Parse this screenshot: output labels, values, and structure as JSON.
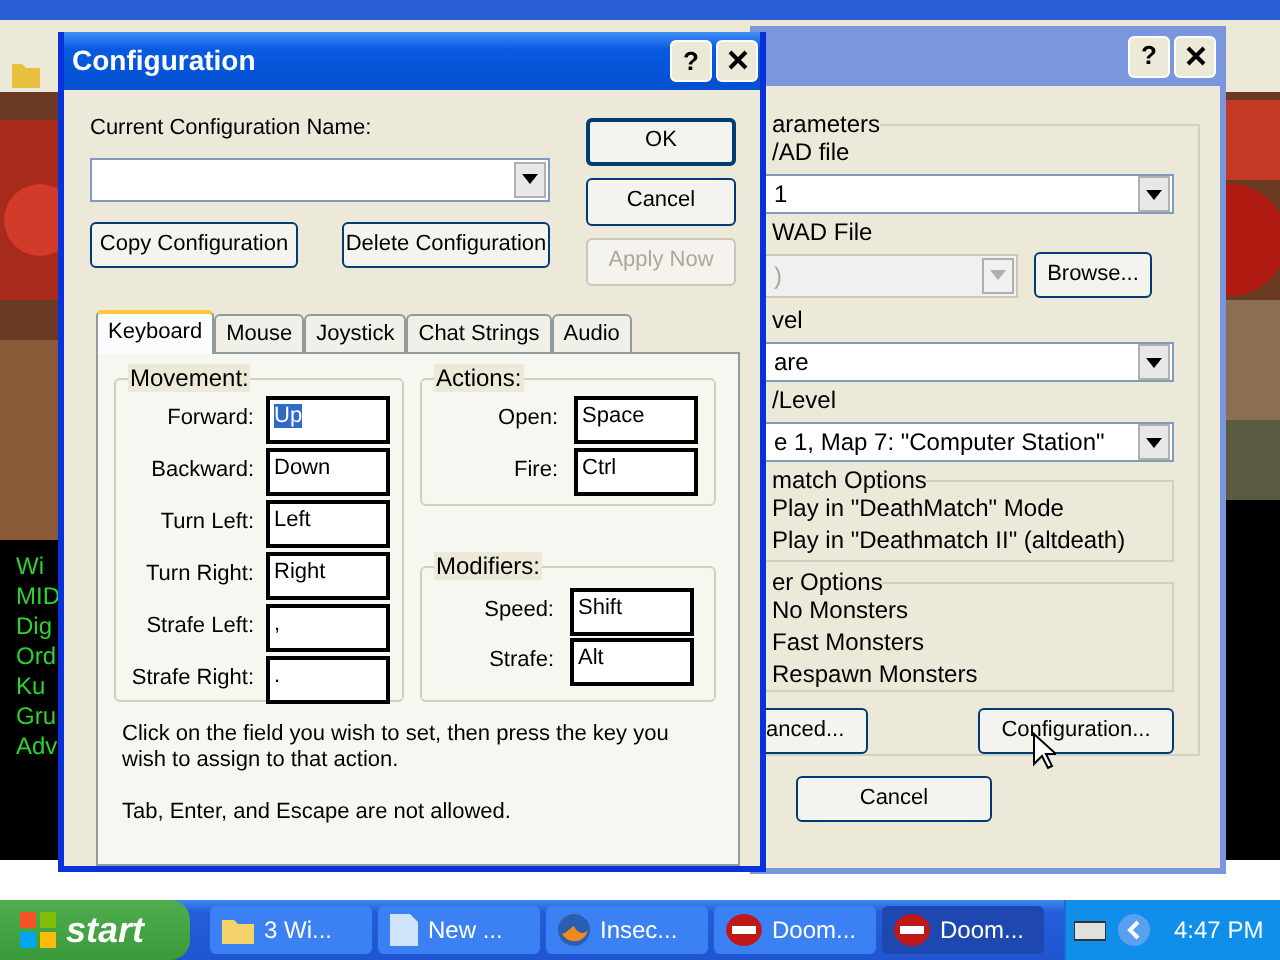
{
  "desktop_text": [
    "Wi",
    "MID",
    "Dig",
    "Ord",
    "Ku",
    "Gru",
    "Adv"
  ],
  "launcher": {
    "help_button": "?",
    "group_label": "arameters",
    "wad_label": "/AD file",
    "wad_value": "1",
    "pwad_label": "WAD File",
    "pwad_value": ")",
    "browse_button": "Browse...",
    "skill_label": "vel",
    "skill_value": "are",
    "map_label": "/Level",
    "map_value": "e 1, Map 7: \"Computer Station\"",
    "dm_label": "match Options",
    "dm_options": [
      "Play in \"DeathMatch\" Mode",
      "Play in \"Deathmatch II\" (altdeath)"
    ],
    "other_label": "er Options",
    "other_options": [
      "No Monsters",
      "Fast Monsters",
      "Respawn Monsters"
    ],
    "buttons": [
      "anced...",
      "Configuration..."
    ],
    "cancel_button": "Cancel"
  },
  "dialog": {
    "title": "Configuration",
    "help_button": "?",
    "name_label": "Current Configuration Name:",
    "side_buttons": [
      {
        "label": "OK",
        "disabled": false,
        "default": true
      },
      {
        "label": "Cancel",
        "disabled": false,
        "default": false
      },
      {
        "label": "Apply Now",
        "disabled": true,
        "default": false
      }
    ],
    "buttons": [
      "Copy Configuration",
      "Delete Configuration"
    ],
    "tabs": [
      {
        "label": "Keyboard",
        "selected": true
      },
      {
        "label": "Mouse",
        "selected": false
      },
      {
        "label": "Joystick",
        "selected": false
      },
      {
        "label": "Chat Strings",
        "selected": false
      },
      {
        "label": "Audio",
        "selected": false
      }
    ],
    "movement": {
      "title": "Movement:",
      "fields": [
        {
          "label": "Forward:",
          "value": "Up",
          "focused": true
        },
        {
          "label": "Backward:",
          "value": "Down",
          "focused": false
        },
        {
          "label": "Turn Left:",
          "value": "Left",
          "focused": false
        },
        {
          "label": "Turn Right:",
          "value": "Right",
          "focused": false
        },
        {
          "label": "Strafe Left:",
          "value": ",",
          "focused": false
        },
        {
          "label": "Strafe Right:",
          "value": ".",
          "focused": false
        }
      ]
    },
    "actions": {
      "title": "Actions:",
      "fields": [
        {
          "label": "Open:",
          "value": "Space",
          "focused": false
        },
        {
          "label": "Fire:",
          "value": "Ctrl",
          "focused": false
        }
      ]
    },
    "modifiers": {
      "title": "Modifiers:",
      "fields": [
        {
          "label": "Speed:",
          "value": "Shift",
          "focused": false
        },
        {
          "label": "Strafe:",
          "value": "Alt",
          "focused": false
        }
      ]
    },
    "notes": [
      "Click on the field you wish to set, then press the key you wish to assign to that action.",
      "Tab, Enter, and Escape are not allowed."
    ]
  },
  "taskbar": {
    "start": "start",
    "items": [
      {
        "label": "3 Wi...",
        "kind": "folder",
        "selected": false
      },
      {
        "label": "New ...",
        "kind": "document",
        "selected": false
      },
      {
        "label": "Insec...",
        "kind": "browser",
        "selected": false
      },
      {
        "label": "Doom...",
        "kind": "game",
        "selected": false
      },
      {
        "label": "Doom...",
        "kind": "game",
        "selected": true
      }
    ],
    "clock": "4:47 PM"
  }
}
